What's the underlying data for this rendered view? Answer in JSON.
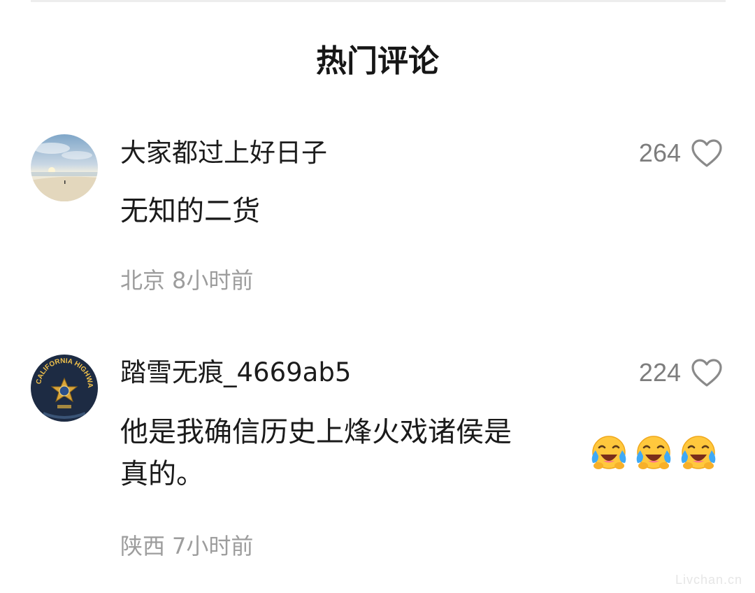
{
  "section_title": "热门评论",
  "comments": [
    {
      "avatar_icon": "beach-sunset-avatar",
      "username": "大家都过上好日子",
      "like_count": "264",
      "text": "无知的二货",
      "location": "北京",
      "time": "8小时前"
    },
    {
      "avatar_icon": "highway-patrol-badge-avatar",
      "avatar_badge_text": "CALIFORNIA HIGHWAY PATROL",
      "username": "踏雪无痕_4669ab5",
      "like_count": "224",
      "text": "他是我确信历史上烽火戏诸侯是真的。",
      "text_lines": [
        "他是我确信历史上烽火戏诸侯是",
        "真的。"
      ],
      "emojis": [
        "tears-of-joy-icon",
        "tears-of-joy-icon",
        "tears-of-joy-icon"
      ],
      "location": "陕西",
      "time": "7小时前"
    }
  ],
  "watermark": "Livchan.cn",
  "colors": {
    "text_primary": "#1b1b1b",
    "text_secondary": "#9d9d9d",
    "like_count": "#7d7d7d",
    "divider": "#ededed",
    "emoji_face": "#ffc83d",
    "emoji_tears": "#3fa9f5"
  }
}
